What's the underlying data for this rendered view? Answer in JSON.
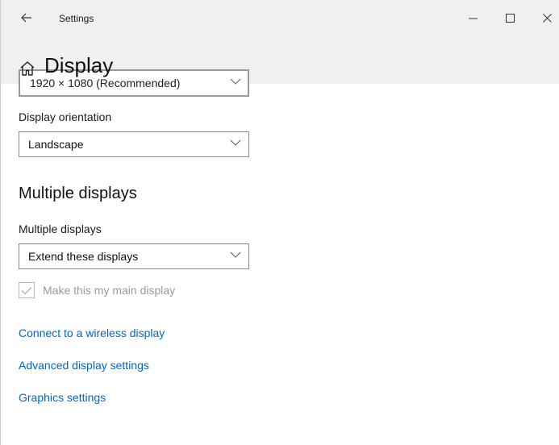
{
  "window": {
    "title": "Settings"
  },
  "header": {
    "page_title": "Display"
  },
  "resolution": {
    "value": "1920 × 1080 (Recommended)"
  },
  "orientation": {
    "label": "Display orientation",
    "value": "Landscape"
  },
  "multiple_displays": {
    "heading": "Multiple displays",
    "label": "Multiple displays",
    "value": "Extend these displays",
    "main_display_checkbox": {
      "label": "Make this my main display",
      "checked": true,
      "disabled": true
    }
  },
  "links": {
    "wireless": "Connect to a wireless display",
    "advanced": "Advanced display settings",
    "graphics": "Graphics settings"
  },
  "colors": {
    "link": "#0067c0",
    "title_bar": "#f0f0f0",
    "disabled_text": "#9a9a9a"
  },
  "icons": {
    "back": "arrow-left-icon",
    "minimize": "minimize-icon",
    "maximize": "maximize-icon",
    "close": "close-icon",
    "home": "home-icon",
    "chevron": "chevron-down-icon",
    "check": "checkmark-icon"
  }
}
